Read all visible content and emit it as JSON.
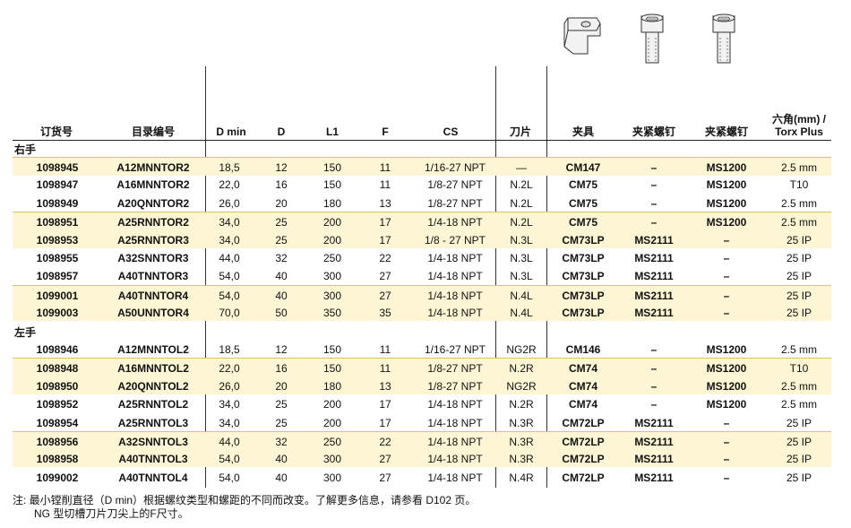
{
  "headers": {
    "order_no": "订货号",
    "catalog_no": "目录编号",
    "dmin": "D min",
    "d": "D",
    "l1": "L1",
    "f": "F",
    "cs": "CS",
    "insert": "刀片",
    "clamp": "夹具",
    "clamp_screw": "夹紧螺钉",
    "clamp_screw2": "夹紧螺钉",
    "hex_line1": "六角(mm) /",
    "hex_line2": "Torx Plus"
  },
  "sections": {
    "right": "右手",
    "left": "左手"
  },
  "right_rows": [
    {
      "order": "1098945",
      "catalog": "A12MNNTOR2",
      "dmin": "18,5",
      "d": "12",
      "l1": "150",
      "f": "11",
      "cs": "1/16-27 NPT",
      "insert": "—",
      "clamp": "CM147",
      "screw": "–",
      "screw2": "MS1200",
      "hex": "2.5 mm"
    },
    {
      "order": "1098947",
      "catalog": "A16MNNTOR2",
      "dmin": "22,0",
      "d": "16",
      "l1": "150",
      "f": "11",
      "cs": "1/8-27 NPT",
      "insert": "N.2L",
      "clamp": "CM75",
      "screw": "–",
      "screw2": "MS1200",
      "hex": "T10"
    },
    {
      "order": "1098949",
      "catalog": "A20QNNTOR2",
      "dmin": "26,0",
      "d": "20",
      "l1": "180",
      "f": "13",
      "cs": "1/8-27 NPT",
      "insert": "N.2L",
      "clamp": "CM75",
      "screw": "–",
      "screw2": "MS1200",
      "hex": "2.5 mm"
    },
    {
      "order": "1098951",
      "catalog": "A25RNNTOR2",
      "dmin": "34,0",
      "d": "25",
      "l1": "200",
      "f": "17",
      "cs": "1/4-18 NPT",
      "insert": "N.2L",
      "clamp": "CM75",
      "screw": "–",
      "screw2": "MS1200",
      "hex": "2.5 mm"
    },
    {
      "order": "1098953",
      "catalog": "A25RNNTOR3",
      "dmin": "34,0",
      "d": "25",
      "l1": "200",
      "f": "17",
      "cs": "1/8 - 27 NPT",
      "insert": "N.3L",
      "clamp": "CM73LP",
      "screw": "MS2111",
      "screw2": "–",
      "hex": "25 IP"
    },
    {
      "order": "1098955",
      "catalog": "A32SNNTOR3",
      "dmin": "44,0",
      "d": "32",
      "l1": "250",
      "f": "22",
      "cs": "1/4-18 NPT",
      "insert": "N.3L",
      "clamp": "CM73LP",
      "screw": "MS2111",
      "screw2": "–",
      "hex": "25 IP"
    },
    {
      "order": "1098957",
      "catalog": "A40TNNTOR3",
      "dmin": "54,0",
      "d": "40",
      "l1": "300",
      "f": "27",
      "cs": "1/4-18 NPT",
      "insert": "N.3L",
      "clamp": "CM73LP",
      "screw": "MS2111",
      "screw2": "–",
      "hex": "25 IP"
    },
    {
      "order": "1099001",
      "catalog": "A40TNNTOR4",
      "dmin": "54,0",
      "d": "40",
      "l1": "300",
      "f": "27",
      "cs": "1/4-18 NPT",
      "insert": "N.4L",
      "clamp": "CM73LP",
      "screw": "MS2111",
      "screw2": "–",
      "hex": "25 IP"
    },
    {
      "order": "1099003",
      "catalog": "A50UNNTOR4",
      "dmin": "70,0",
      "d": "50",
      "l1": "350",
      "f": "35",
      "cs": "1/4-18 NPT",
      "insert": "N.4L",
      "clamp": "CM73LP",
      "screw": "MS2111",
      "screw2": "–",
      "hex": "25 IP"
    }
  ],
  "left_rows": [
    {
      "order": "1098946",
      "catalog": "A12MNNTOL2",
      "dmin": "18,5",
      "d": "12",
      "l1": "150",
      "f": "11",
      "cs": "1/16-27 NPT",
      "insert": "NG2R",
      "clamp": "CM146",
      "screw": "–",
      "screw2": "MS1200",
      "hex": "2.5 mm"
    },
    {
      "order": "1098948",
      "catalog": "A16MNNTOL2",
      "dmin": "22,0",
      "d": "16",
      "l1": "150",
      "f": "11",
      "cs": "1/8-27 NPT",
      "insert": "N.2R",
      "clamp": "CM74",
      "screw": "–",
      "screw2": "MS1200",
      "hex": "T10"
    },
    {
      "order": "1098950",
      "catalog": "A20QNNTOL2",
      "dmin": "26,0",
      "d": "20",
      "l1": "180",
      "f": "13",
      "cs": "1/8-27 NPT",
      "insert": "NG2R",
      "clamp": "CM74",
      "screw": "–",
      "screw2": "MS1200",
      "hex": "2.5 mm"
    },
    {
      "order": "1098952",
      "catalog": "A25RNNTOL2",
      "dmin": "34,0",
      "d": "25",
      "l1": "200",
      "f": "17",
      "cs": "1/4-18 NPT",
      "insert": "N.2R",
      "clamp": "CM74",
      "screw": "–",
      "screw2": "MS1200",
      "hex": "2.5 mm"
    },
    {
      "order": "1098954",
      "catalog": "A25RNNTOL3",
      "dmin": "34,0",
      "d": "25",
      "l1": "200",
      "f": "17",
      "cs": "1/4-18 NPT",
      "insert": "N.3R",
      "clamp": "CM72LP",
      "screw": "MS2111",
      "screw2": "–",
      "hex": "25 IP"
    },
    {
      "order": "1098956",
      "catalog": "A32SNNTOL3",
      "dmin": "44,0",
      "d": "32",
      "l1": "250",
      "f": "22",
      "cs": "1/4-18 NPT",
      "insert": "N.3R",
      "clamp": "CM72LP",
      "screw": "MS2111",
      "screw2": "–",
      "hex": "25 IP"
    },
    {
      "order": "1098958",
      "catalog": "A40TNNTOL3",
      "dmin": "54,0",
      "d": "40",
      "l1": "300",
      "f": "27",
      "cs": "1/4-18 NPT",
      "insert": "N.3R",
      "clamp": "CM72LP",
      "screw": "MS2111",
      "screw2": "–",
      "hex": "25 IP"
    },
    {
      "order": "1099002",
      "catalog": "A40TNNTOL4",
      "dmin": "54,0",
      "d": "40",
      "l1": "300",
      "f": "27",
      "cs": "1/4-18 NPT",
      "insert": "N.4R",
      "clamp": "CM72LP",
      "screw": "MS2111",
      "screw2": "–",
      "hex": "25 IP"
    }
  ],
  "notes": {
    "line1": "注:  最小镗削直径（D min）根据螺纹类型和螺距的不同而改变。了解更多信息，请参看 D102 页。",
    "line2": "NG 型切槽刀片刀尖上的F尺寸。"
  },
  "icons": [
    "clamp-icon",
    "clamp-screw-icon",
    "clamp-screw-icon"
  ],
  "colors": {
    "band": "#fdf5d4",
    "rule": "#e0c35a"
  }
}
